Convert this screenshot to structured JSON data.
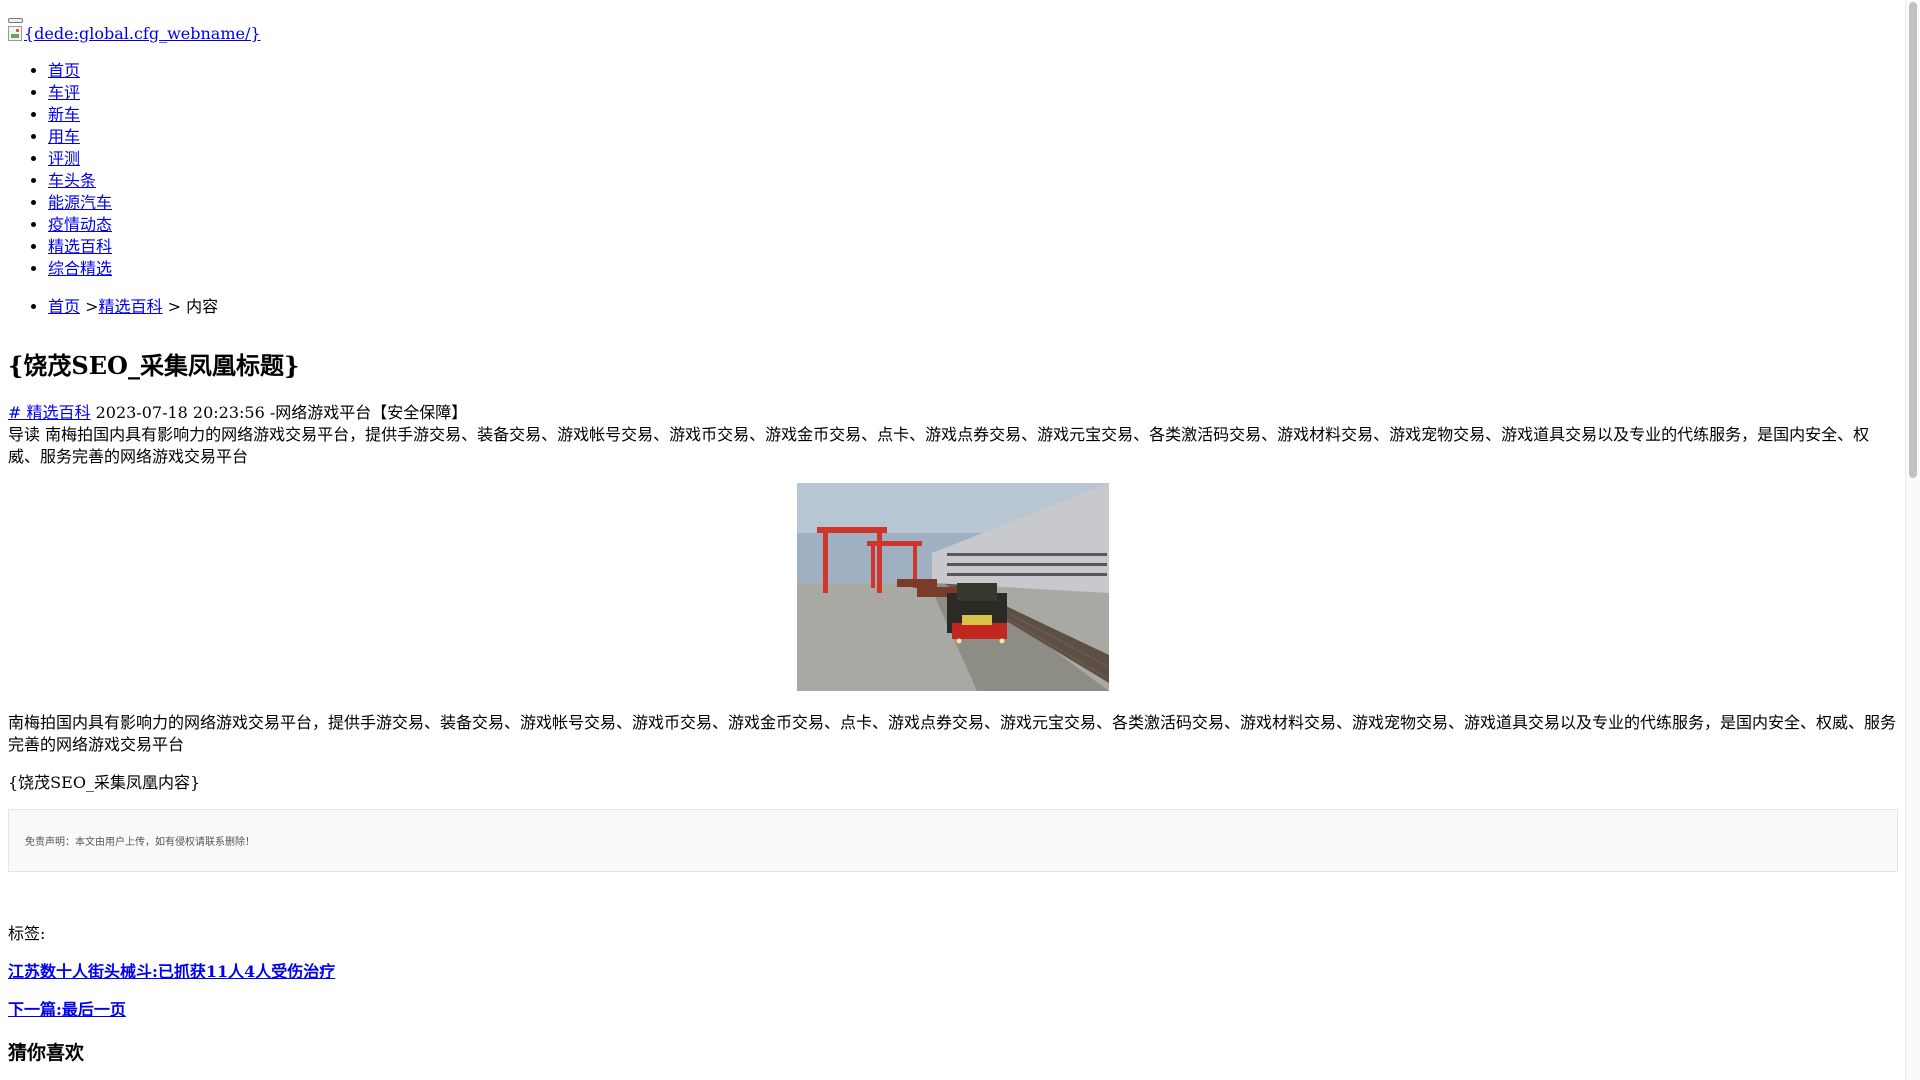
{
  "header": {
    "logo_alt": "{dede:global.cfg_webname/}"
  },
  "nav": {
    "items": [
      {
        "label": "首页"
      },
      {
        "label": "车评"
      },
      {
        "label": "新车"
      },
      {
        "label": "用车"
      },
      {
        "label": "评测"
      },
      {
        "label": "车头条"
      },
      {
        "label": "能源汽车"
      },
      {
        "label": "疫情动态"
      },
      {
        "label": "精选百科"
      },
      {
        "label": "综合精选"
      }
    ]
  },
  "breadcrumb": {
    "home": "首页",
    "sep1": " >",
    "category": "精选百科",
    "sep2": " > ",
    "current": "内容"
  },
  "article": {
    "title": "{饶茂SEO_采集凤凰标题}",
    "category_tag": "# 精选百科",
    "meta_text": " 2023-07-18 20:23:56 -网络游戏平台【安全保障】",
    "lead": "导读 南梅拍国内具有影响力的网络游戏交易平台，提供手游交易、装备交易、游戏帐号交易、游戏币交易、游戏金币交易、点卡、游戏点券交易、游戏元宝交易、各类激活码交易、游戏材料交易、游戏宠物交易、游戏道具交易以及专业的代练服务，是国内安全、权威、服务完善的网络游戏交易平台",
    "body": "南梅拍国内具有影响力的网络游戏交易平台，提供手游交易、装备交易、游戏帐号交易、游戏币交易、游戏金币交易、点卡、游戏点券交易、游戏元宝交易、各类激活码交易、游戏材料交易、游戏宠物交易、游戏道具交易以及专业的代练服务，是国内安全、权威、服务完善的网络游戏交易平台",
    "content_placeholder": "{饶茂SEO_采集凤凰内容}",
    "disclaimer": "免责声明：本文由用户上传，如有侵权请联系删除！",
    "tags_label": "标签:",
    "prev_link": "江苏数十人街头械斗:已抓获11人4人受伤治疗",
    "next_link": "下一篇:最后一页",
    "related_heading": "猜你喜欢"
  },
  "colors": {
    "link": "#0000ee",
    "text": "#000000",
    "disclaimer_bg": "#f9f9f9",
    "disclaimer_border": "#e5e5e5"
  }
}
